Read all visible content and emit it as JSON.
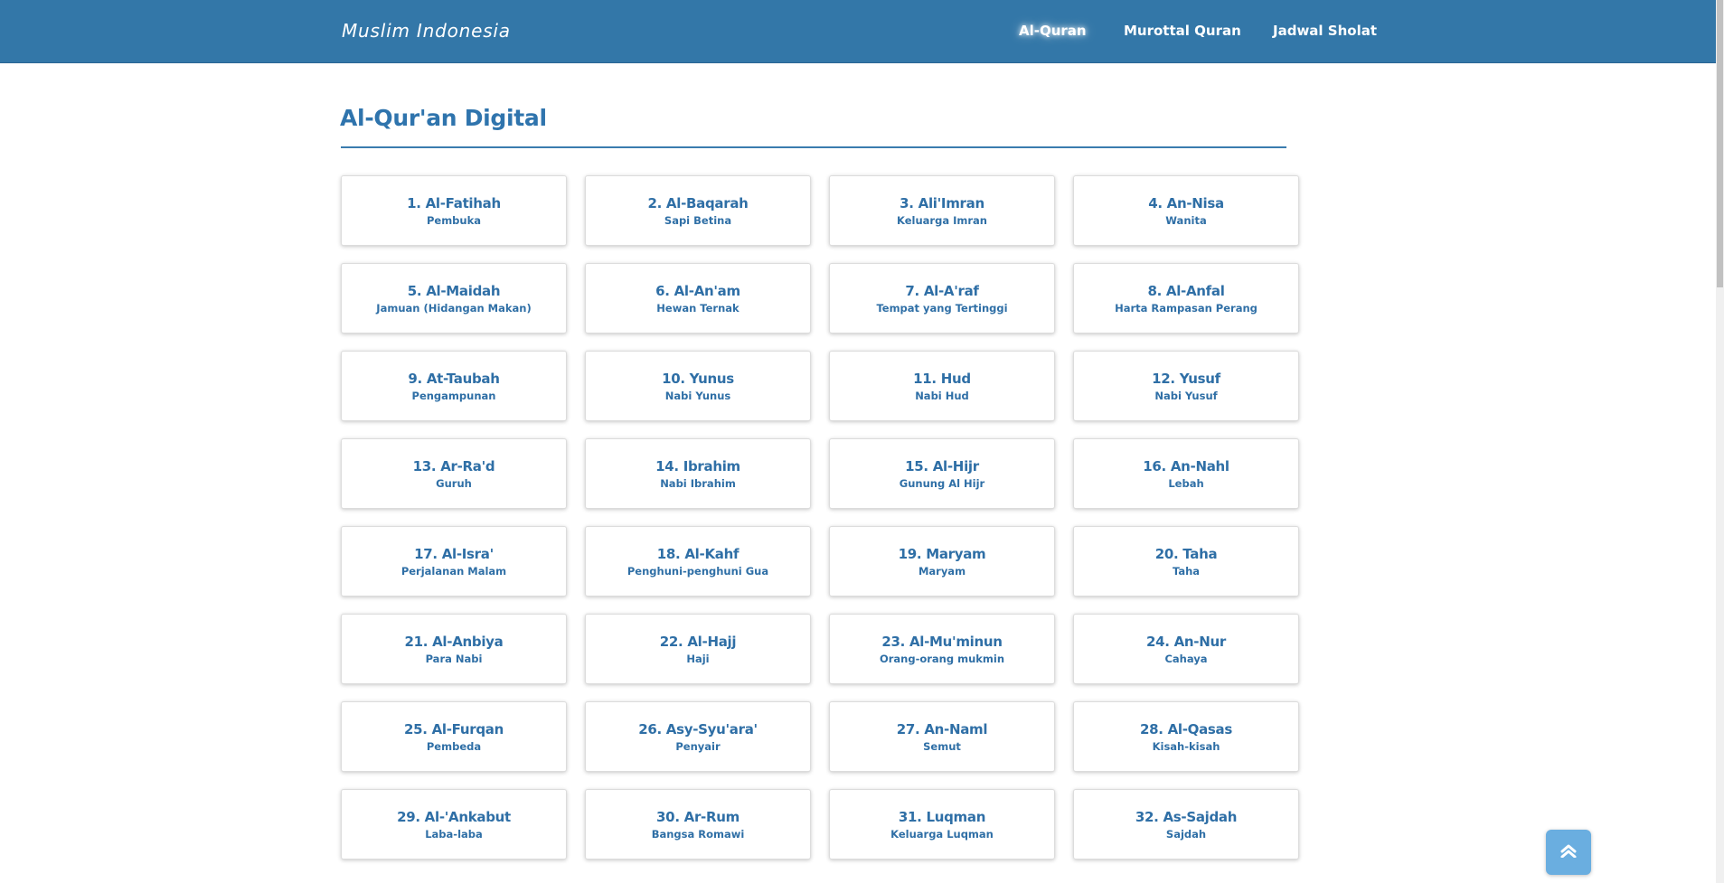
{
  "navbar": {
    "brand": "Muslim Indonesia",
    "links": [
      {
        "label": "Al-Quran",
        "active": true
      },
      {
        "label": "Murottal Quran",
        "active": false
      },
      {
        "label": "Jadwal Sholat",
        "active": false
      }
    ]
  },
  "main": {
    "title": "Al-Qur'an Digital",
    "surahs": [
      {
        "title": "1. Al-Fatihah",
        "meaning": "Pembuka"
      },
      {
        "title": "2. Al-Baqarah",
        "meaning": "Sapi Betina"
      },
      {
        "title": "3. Ali'Imran",
        "meaning": "Keluarga Imran"
      },
      {
        "title": "4. An-Nisa",
        "meaning": "Wanita"
      },
      {
        "title": "5. Al-Maidah",
        "meaning": "Jamuan (Hidangan Makan)"
      },
      {
        "title": "6. Al-An'am",
        "meaning": "Hewan Ternak"
      },
      {
        "title": "7. Al-A'raf",
        "meaning": "Tempat yang Tertinggi"
      },
      {
        "title": "8. Al-Anfal",
        "meaning": "Harta Rampasan Perang"
      },
      {
        "title": "9. At-Taubah",
        "meaning": "Pengampunan"
      },
      {
        "title": "10. Yunus",
        "meaning": "Nabi Yunus"
      },
      {
        "title": "11. Hud",
        "meaning": "Nabi Hud"
      },
      {
        "title": "12. Yusuf",
        "meaning": "Nabi Yusuf"
      },
      {
        "title": "13. Ar-Ra'd",
        "meaning": "Guruh"
      },
      {
        "title": "14. Ibrahim",
        "meaning": "Nabi Ibrahim"
      },
      {
        "title": "15. Al-Hijr",
        "meaning": "Gunung Al Hijr"
      },
      {
        "title": "16. An-Nahl",
        "meaning": "Lebah"
      },
      {
        "title": "17. Al-Isra'",
        "meaning": "Perjalanan Malam"
      },
      {
        "title": "18. Al-Kahf",
        "meaning": "Penghuni-penghuni Gua"
      },
      {
        "title": "19. Maryam",
        "meaning": "Maryam"
      },
      {
        "title": "20. Taha",
        "meaning": "Taha"
      },
      {
        "title": "21. Al-Anbiya",
        "meaning": "Para Nabi"
      },
      {
        "title": "22. Al-Hajj",
        "meaning": "Haji"
      },
      {
        "title": "23. Al-Mu'minun",
        "meaning": "Orang-orang mukmin"
      },
      {
        "title": "24. An-Nur",
        "meaning": "Cahaya"
      },
      {
        "title": "25. Al-Furqan",
        "meaning": "Pembeda"
      },
      {
        "title": "26. Asy-Syu'ara'",
        "meaning": "Penyair"
      },
      {
        "title": "27. An-Naml",
        "meaning": "Semut"
      },
      {
        "title": "28. Al-Qasas",
        "meaning": "Kisah-kisah"
      },
      {
        "title": "29. Al-'Ankabut",
        "meaning": "Laba-laba"
      },
      {
        "title": "30. Ar-Rum",
        "meaning": "Bangsa Romawi"
      },
      {
        "title": "31. Luqman",
        "meaning": "Keluarga Luqman"
      },
      {
        "title": "32. As-Sajdah",
        "meaning": "Sajdah"
      }
    ]
  },
  "scroll_top_button": {
    "icon": "double-chevron-up-icon"
  },
  "colors": {
    "navbar": "#3377a8",
    "accent": "#2f6fa6",
    "scroll_button": "#6aaee0"
  }
}
